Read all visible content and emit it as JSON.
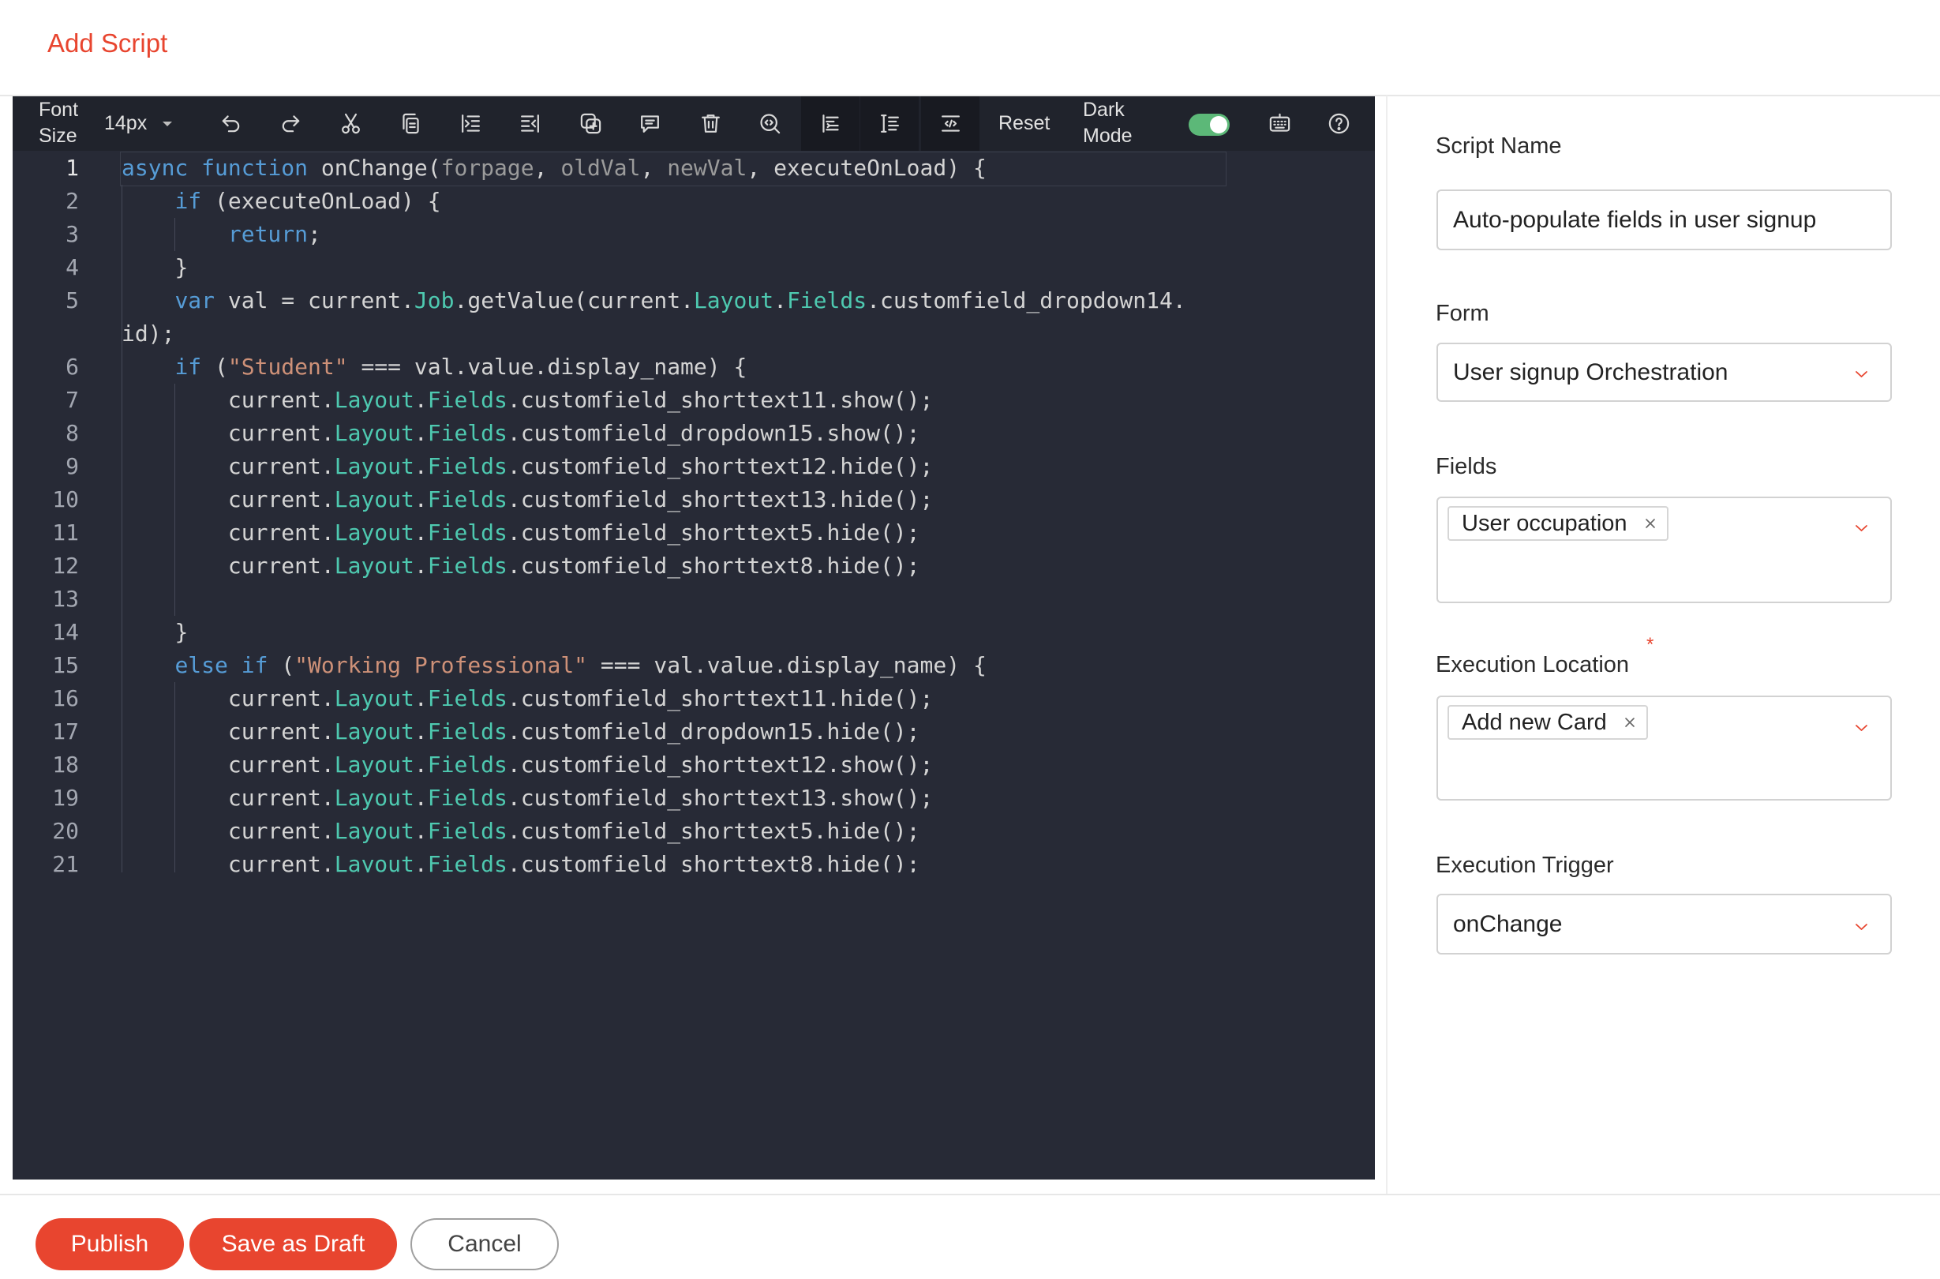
{
  "page": {
    "title": "Add Script"
  },
  "colors": {
    "accent": "#e8452f",
    "toggle_on": "#5cb878",
    "editor_bg": "#272a36",
    "toolbar_bg": "#20232c",
    "keyword": "#569cd6",
    "string": "#ce9178",
    "type": "#4ec9b0",
    "param": "#9b9b9b",
    "code_text": "#d4d4d4"
  },
  "toolbar": {
    "font_size_label": "Font Size",
    "font_size_value": "14px",
    "icons": [
      "undo-icon",
      "redo-icon",
      "cut-icon",
      "copy-icon",
      "indent-icon",
      "outdent-icon",
      "duplicate-icon",
      "comment-icon",
      "delete-icon",
      "find-icon",
      "format-icon",
      "line-numbers-icon",
      "wrap-icon",
      "keyboard-icon",
      "help-icon"
    ],
    "reset_label": "Reset",
    "dark_mode": {
      "label": "Dark Mode",
      "on": true
    }
  },
  "editor": {
    "active_line": 1,
    "lines": [
      {
        "n": 1,
        "code": "async function onChange(forpage, oldVal, newVal, executeOnLoad) {"
      },
      {
        "n": 2,
        "code": "    if (executeOnLoad) {"
      },
      {
        "n": 3,
        "code": "        return;"
      },
      {
        "n": 4,
        "code": "    }"
      },
      {
        "n": 5,
        "code": "    var val = current.Job.getValue(current.Layout.Fields.customfield_dropdown14.id);"
      },
      {
        "n": 6,
        "code": "    if (\"Student\" === val.value.display_name) {"
      },
      {
        "n": 7,
        "code": "        current.Layout.Fields.customfield_shorttext11.show();"
      },
      {
        "n": 8,
        "code": "        current.Layout.Fields.customfield_dropdown15.show();"
      },
      {
        "n": 9,
        "code": "        current.Layout.Fields.customfield_shorttext12.hide();"
      },
      {
        "n": 10,
        "code": "        current.Layout.Fields.customfield_shorttext13.hide();"
      },
      {
        "n": 11,
        "code": "        current.Layout.Fields.customfield_shorttext5.hide();"
      },
      {
        "n": 12,
        "code": "        current.Layout.Fields.customfield_shorttext8.hide();"
      },
      {
        "n": 13,
        "code": ""
      },
      {
        "n": 14,
        "code": "    }"
      },
      {
        "n": 15,
        "code": "    else if (\"Working Professional\" === val.value.display_name) {"
      },
      {
        "n": 16,
        "code": "        current.Layout.Fields.customfield_shorttext11.hide();"
      },
      {
        "n": 17,
        "code": "        current.Layout.Fields.customfield_dropdown15.hide();"
      },
      {
        "n": 18,
        "code": "        current.Layout.Fields.customfield_shorttext12.show();"
      },
      {
        "n": 19,
        "code": "        current.Layout.Fields.customfield_shorttext13.show();"
      },
      {
        "n": 20,
        "code": "        current.Layout.Fields.customfield_shorttext5.hide();"
      },
      {
        "n": 21,
        "code": "        current.Layout.Fields.customfield_shorttext8.hide();"
      }
    ]
  },
  "form": {
    "script_name": {
      "label": "Script Name",
      "value": "Auto-populate fields in user signup"
    },
    "form_select": {
      "label": "Form",
      "value": "User signup Orchestration"
    },
    "fields": {
      "label": "Fields",
      "chips": [
        "User occupation"
      ]
    },
    "execution_location": {
      "label": "Execution Location",
      "required_mark": "*",
      "chips": [
        "Add new Card"
      ]
    },
    "execution_trigger": {
      "label": "Execution Trigger",
      "value": "onChange"
    }
  },
  "footer": {
    "publish": "Publish",
    "save_draft": "Save as Draft",
    "cancel": "Cancel"
  }
}
